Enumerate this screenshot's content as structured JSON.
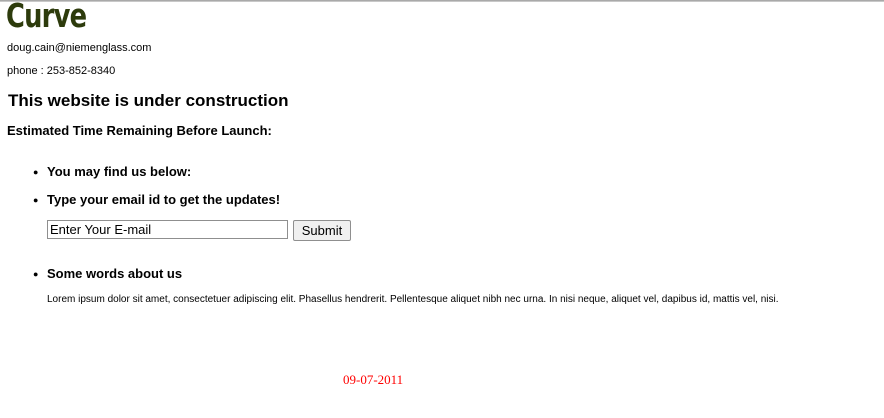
{
  "brand": {
    "logo_text": "Curve",
    "logo_color": "#2d3b0c"
  },
  "contact": {
    "email": "doug.cain@niemenglass.com",
    "phone_label": "phone",
    "phone_separator": " : ",
    "phone": "253-852-8340"
  },
  "main": {
    "heading": "This website is under construction",
    "countdown_label": "Estimated Time Remaining Before Launch:",
    "items": [
      {
        "label": "You may find us below:"
      },
      {
        "label": "Type your email id to get the updates!"
      },
      {
        "label": "Some words about us"
      }
    ]
  },
  "subscribe": {
    "placeholder": "Enter Your E-mail",
    "submit_label": "Submit"
  },
  "about": {
    "text": "Lorem ipsum dolor sit amet, consectetuer adipiscing elit. Phasellus hendrerit. Pellentesque aliquet nibh nec urna. In nisi neque, aliquet vel, dapibus id, mattis vel, nisi."
  },
  "launch": {
    "date": "09-07-2011",
    "color": "#ff0000"
  }
}
